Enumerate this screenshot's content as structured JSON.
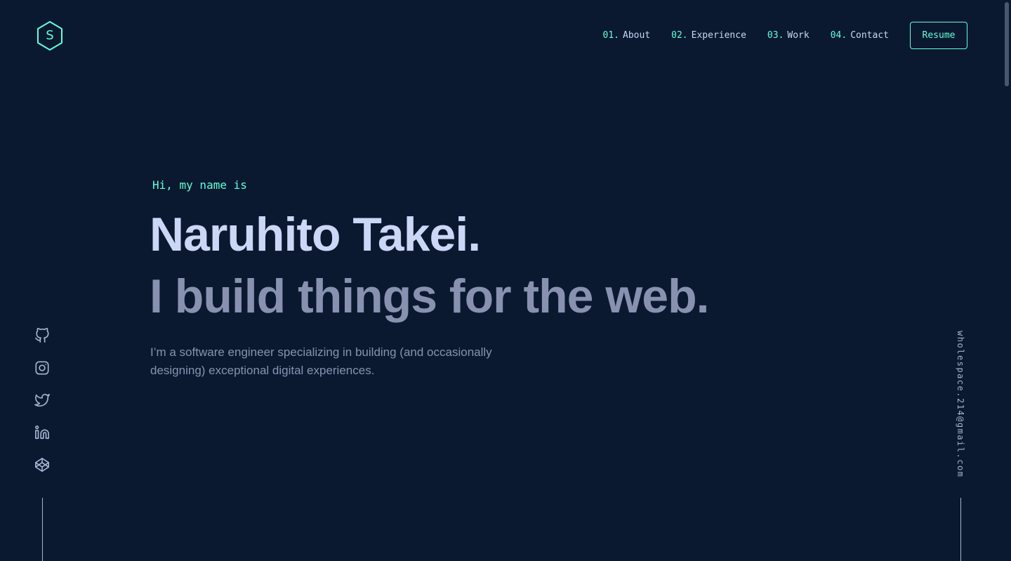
{
  "header": {
    "logo": {
      "letter": "S",
      "icon": "hexagon-logo-icon"
    },
    "nav": [
      {
        "num": "01.",
        "label": "About"
      },
      {
        "num": "02.",
        "label": "Experience"
      },
      {
        "num": "03.",
        "label": "Work"
      },
      {
        "num": "04.",
        "label": "Contact"
      }
    ],
    "resume_label": "Resume"
  },
  "hero": {
    "greeting": "Hi, my name is",
    "name": "Naruhito Takei.",
    "tagline": "I build things for the web.",
    "description": "I’m a software engineer specializing in building (and occasionally designing) exceptional digital experiences."
  },
  "social": {
    "icons": [
      "github-icon",
      "instagram-icon",
      "twitter-icon",
      "linkedin-icon",
      "codepen-icon"
    ]
  },
  "email": "wholespace.214@gmail.com",
  "colors": {
    "background": "#0a192f",
    "accent": "#64ffda",
    "heading": "#ccd6f6",
    "text": "#8892b0",
    "light_text": "#a8b2d1"
  }
}
